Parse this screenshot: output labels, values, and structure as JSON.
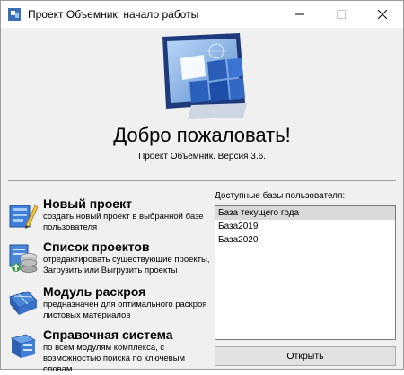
{
  "window": {
    "title": "Проект Объемник: начало работы",
    "icons": {
      "app": "app-icon",
      "minimize": "minimize-icon",
      "maximize": "maximize-icon",
      "close": "close-icon"
    }
  },
  "header": {
    "welcome": "Добро пожаловать!",
    "version": "Проект Объемник. Версия 3.6.",
    "logo_icon": "cube-monitor-icon"
  },
  "actions": [
    {
      "title": "Новый проект",
      "desc": "создать новый проект в выбранной базе пользователя",
      "icon": "new-project-icon"
    },
    {
      "title": "Список проектов",
      "desc": "отредактировать существующие проекты, Загрузить или Выгрузить проекты",
      "icon": "project-list-icon"
    },
    {
      "title": "Модуль раскроя",
      "desc": "предназначен для оптимального раскроя листовых материалов",
      "icon": "cutting-module-icon"
    },
    {
      "title": "Справочная система",
      "desc": "по всем модулям комплекса, с возможностью поиска по ключевым словам",
      "icon": "help-icon"
    }
  ],
  "databases": {
    "label": "Доступные базы пользователя:",
    "items": [
      "База текущего года",
      "База2019",
      "База2020"
    ],
    "selected": "База текущего года"
  },
  "open_button": "Открыть",
  "colors": {
    "accent_blue": "#2f6fd6",
    "selection": "#d9d9d9",
    "window_bg": "#f0f0f0"
  }
}
